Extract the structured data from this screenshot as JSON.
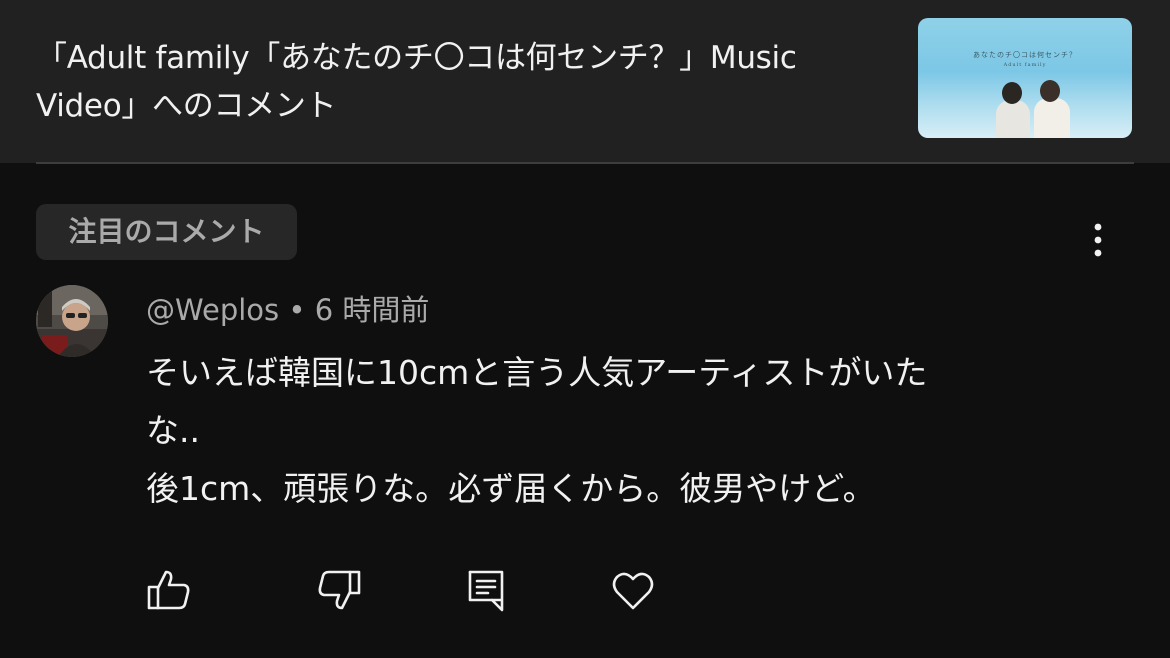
{
  "header": {
    "title": "「Adult family「あなたのチ〇コは何センチ？」Music Video」へのコメント",
    "thumbnail": {
      "caption": "あなたのチ〇コは何センチ？",
      "sub": "Adult family"
    }
  },
  "chip": {
    "label": "注目のコメント"
  },
  "comment": {
    "author": "@Weplos",
    "separator": " • ",
    "time": "6 時間前",
    "lines": [
      "そいえば韓国に10cmと言う人気アーティストがいた",
      "な..",
      "後1cm、頑張りな。必ず届くから。彼男やけど。"
    ]
  },
  "actions": {
    "like": "like-icon",
    "dislike": "dislike-icon",
    "reply": "reply-icon",
    "heart": "heart-icon"
  },
  "colors": {
    "background": "#0f0f0f",
    "header_bg": "#212121",
    "text": "#f1f1f1",
    "secondary_text": "#aaaaaa",
    "chip_bg": "#272727"
  }
}
